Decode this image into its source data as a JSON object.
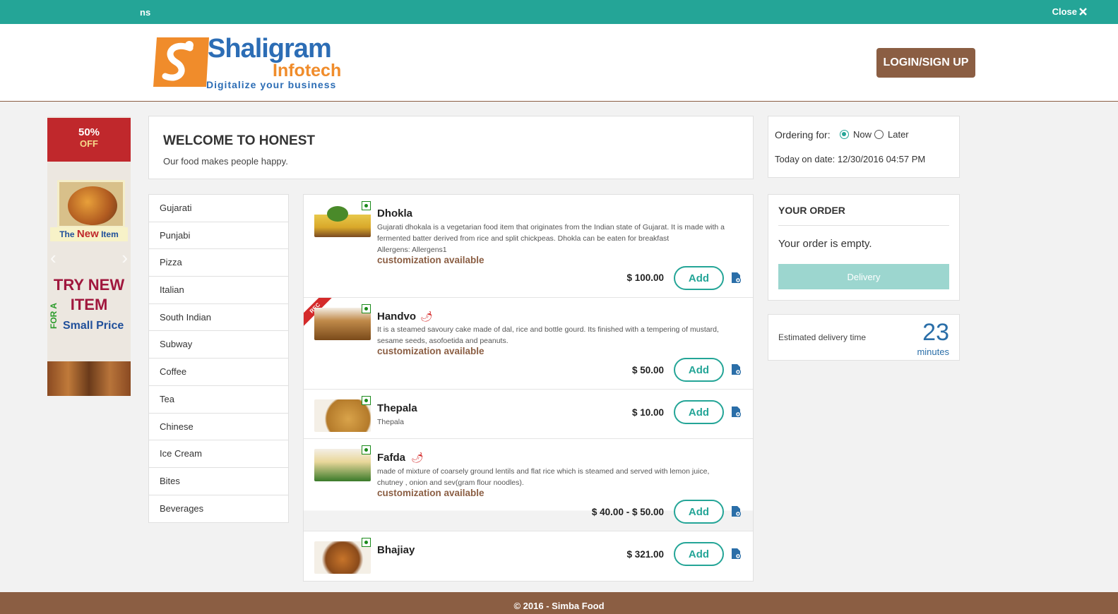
{
  "topbar": {
    "notice": "ns",
    "close_label": "Close"
  },
  "header": {
    "logo": {
      "name": "Shaligram",
      "sub": "Infotech",
      "tagline": "Digitalize your business"
    },
    "login_label": "LOGIN/SIGN UP"
  },
  "ad": {
    "percent": "50%",
    "off": "OFF",
    "the": "The",
    "new": "New",
    "item": "Item",
    "try_line1": "TRY NEW",
    "try_line2": "ITEM",
    "for_a": "FOR A",
    "small_price": "Small Price"
  },
  "welcome": {
    "title": "WELCOME TO HONEST",
    "subtitle": "Our food makes people happy."
  },
  "categories": [
    "Gujarati",
    "Punjabi",
    "Pizza",
    "Italian",
    "South Indian",
    "Subway",
    "Coffee",
    "Tea",
    "Chinese",
    "Ice Cream",
    "Bites",
    "Beverages"
  ],
  "items": [
    {
      "name": "Dhokla",
      "desc": "Gujarati dhokala is a vegetarian food item that originates from the Indian state of Gujarat. It is made with a fermented batter derived from rice and split chickpeas. Dhokla can be eaten for breakfast",
      "allergens": "Allergens: Allergens1",
      "custom": "customization available",
      "price": "$ 100.00",
      "add": "Add"
    },
    {
      "name": "Handvo",
      "rec": "REC",
      "desc": "It is a steamed savoury cake made of dal, rice and bottle gourd. Its finished with a tempering of mustard, sesame seeds, asofoetida and peanuts.",
      "custom": "customization available",
      "price": "$ 50.00",
      "add": "Add"
    },
    {
      "name": "Thepala",
      "desc": "Thepala",
      "price": "$ 10.00",
      "add": "Add"
    },
    {
      "name": "Fafda",
      "desc": "made of mixture of coarsely ground lentils and flat rice which is steamed and served with lemon juice, chutney , onion and sev(gram flour noodles).",
      "custom": "customization available",
      "price": "$ 40.00 - $ 50.00",
      "add": "Add"
    },
    {
      "name": "Bhajiay",
      "price": "$ 321.00",
      "add": "Add"
    }
  ],
  "ordering": {
    "label": "Ordering for:",
    "now": "Now",
    "later": "Later",
    "date": "Today on date: 12/30/2016 04:57 PM",
    "selected": "Now"
  },
  "order": {
    "title": "YOUR ORDER",
    "empty": "Your order is empty.",
    "delivery": "Delivery"
  },
  "eta": {
    "label": "Estimated delivery time",
    "value": "23",
    "unit": "minutes"
  },
  "footer": {
    "text": "© 2016 - Simba Food"
  },
  "colors": {
    "teal": "#24a597",
    "brown": "#8b5e43",
    "veg": "#1a8a1a",
    "link_blue": "#2a6ea8"
  }
}
